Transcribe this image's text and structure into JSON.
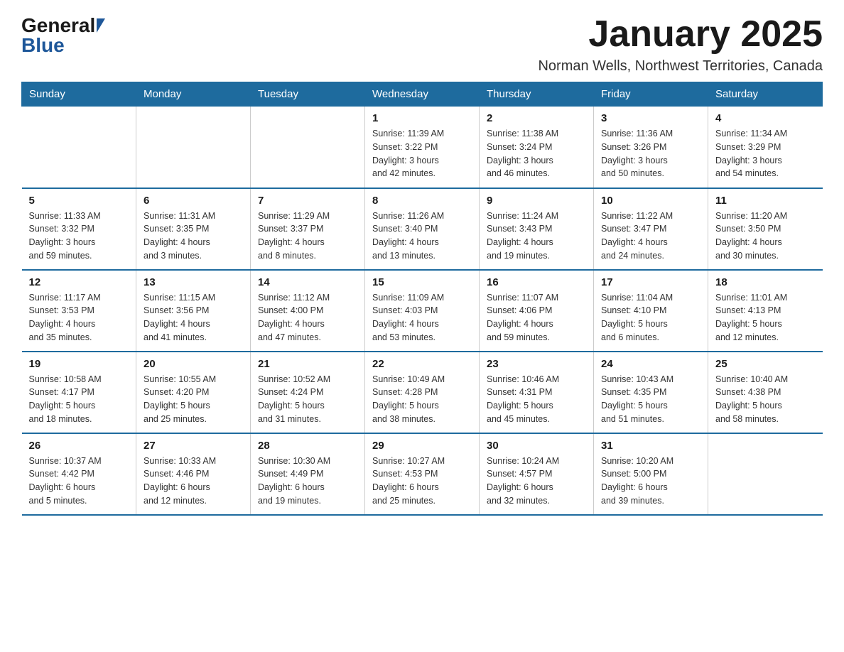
{
  "header": {
    "logo_general": "General",
    "logo_blue": "Blue",
    "month_title": "January 2025",
    "location": "Norman Wells, Northwest Territories, Canada"
  },
  "days_of_week": [
    "Sunday",
    "Monday",
    "Tuesday",
    "Wednesday",
    "Thursday",
    "Friday",
    "Saturday"
  ],
  "weeks": [
    [
      {
        "day": "",
        "info": ""
      },
      {
        "day": "",
        "info": ""
      },
      {
        "day": "",
        "info": ""
      },
      {
        "day": "1",
        "info": "Sunrise: 11:39 AM\nSunset: 3:22 PM\nDaylight: 3 hours\nand 42 minutes."
      },
      {
        "day": "2",
        "info": "Sunrise: 11:38 AM\nSunset: 3:24 PM\nDaylight: 3 hours\nand 46 minutes."
      },
      {
        "day": "3",
        "info": "Sunrise: 11:36 AM\nSunset: 3:26 PM\nDaylight: 3 hours\nand 50 minutes."
      },
      {
        "day": "4",
        "info": "Sunrise: 11:34 AM\nSunset: 3:29 PM\nDaylight: 3 hours\nand 54 minutes."
      }
    ],
    [
      {
        "day": "5",
        "info": "Sunrise: 11:33 AM\nSunset: 3:32 PM\nDaylight: 3 hours\nand 59 minutes."
      },
      {
        "day": "6",
        "info": "Sunrise: 11:31 AM\nSunset: 3:35 PM\nDaylight: 4 hours\nand 3 minutes."
      },
      {
        "day": "7",
        "info": "Sunrise: 11:29 AM\nSunset: 3:37 PM\nDaylight: 4 hours\nand 8 minutes."
      },
      {
        "day": "8",
        "info": "Sunrise: 11:26 AM\nSunset: 3:40 PM\nDaylight: 4 hours\nand 13 minutes."
      },
      {
        "day": "9",
        "info": "Sunrise: 11:24 AM\nSunset: 3:43 PM\nDaylight: 4 hours\nand 19 minutes."
      },
      {
        "day": "10",
        "info": "Sunrise: 11:22 AM\nSunset: 3:47 PM\nDaylight: 4 hours\nand 24 minutes."
      },
      {
        "day": "11",
        "info": "Sunrise: 11:20 AM\nSunset: 3:50 PM\nDaylight: 4 hours\nand 30 minutes."
      }
    ],
    [
      {
        "day": "12",
        "info": "Sunrise: 11:17 AM\nSunset: 3:53 PM\nDaylight: 4 hours\nand 35 minutes."
      },
      {
        "day": "13",
        "info": "Sunrise: 11:15 AM\nSunset: 3:56 PM\nDaylight: 4 hours\nand 41 minutes."
      },
      {
        "day": "14",
        "info": "Sunrise: 11:12 AM\nSunset: 4:00 PM\nDaylight: 4 hours\nand 47 minutes."
      },
      {
        "day": "15",
        "info": "Sunrise: 11:09 AM\nSunset: 4:03 PM\nDaylight: 4 hours\nand 53 minutes."
      },
      {
        "day": "16",
        "info": "Sunrise: 11:07 AM\nSunset: 4:06 PM\nDaylight: 4 hours\nand 59 minutes."
      },
      {
        "day": "17",
        "info": "Sunrise: 11:04 AM\nSunset: 4:10 PM\nDaylight: 5 hours\nand 6 minutes."
      },
      {
        "day": "18",
        "info": "Sunrise: 11:01 AM\nSunset: 4:13 PM\nDaylight: 5 hours\nand 12 minutes."
      }
    ],
    [
      {
        "day": "19",
        "info": "Sunrise: 10:58 AM\nSunset: 4:17 PM\nDaylight: 5 hours\nand 18 minutes."
      },
      {
        "day": "20",
        "info": "Sunrise: 10:55 AM\nSunset: 4:20 PM\nDaylight: 5 hours\nand 25 minutes."
      },
      {
        "day": "21",
        "info": "Sunrise: 10:52 AM\nSunset: 4:24 PM\nDaylight: 5 hours\nand 31 minutes."
      },
      {
        "day": "22",
        "info": "Sunrise: 10:49 AM\nSunset: 4:28 PM\nDaylight: 5 hours\nand 38 minutes."
      },
      {
        "day": "23",
        "info": "Sunrise: 10:46 AM\nSunset: 4:31 PM\nDaylight: 5 hours\nand 45 minutes."
      },
      {
        "day": "24",
        "info": "Sunrise: 10:43 AM\nSunset: 4:35 PM\nDaylight: 5 hours\nand 51 minutes."
      },
      {
        "day": "25",
        "info": "Sunrise: 10:40 AM\nSunset: 4:38 PM\nDaylight: 5 hours\nand 58 minutes."
      }
    ],
    [
      {
        "day": "26",
        "info": "Sunrise: 10:37 AM\nSunset: 4:42 PM\nDaylight: 6 hours\nand 5 minutes."
      },
      {
        "day": "27",
        "info": "Sunrise: 10:33 AM\nSunset: 4:46 PM\nDaylight: 6 hours\nand 12 minutes."
      },
      {
        "day": "28",
        "info": "Sunrise: 10:30 AM\nSunset: 4:49 PM\nDaylight: 6 hours\nand 19 minutes."
      },
      {
        "day": "29",
        "info": "Sunrise: 10:27 AM\nSunset: 4:53 PM\nDaylight: 6 hours\nand 25 minutes."
      },
      {
        "day": "30",
        "info": "Sunrise: 10:24 AM\nSunset: 4:57 PM\nDaylight: 6 hours\nand 32 minutes."
      },
      {
        "day": "31",
        "info": "Sunrise: 10:20 AM\nSunset: 5:00 PM\nDaylight: 6 hours\nand 39 minutes."
      },
      {
        "day": "",
        "info": ""
      }
    ]
  ]
}
